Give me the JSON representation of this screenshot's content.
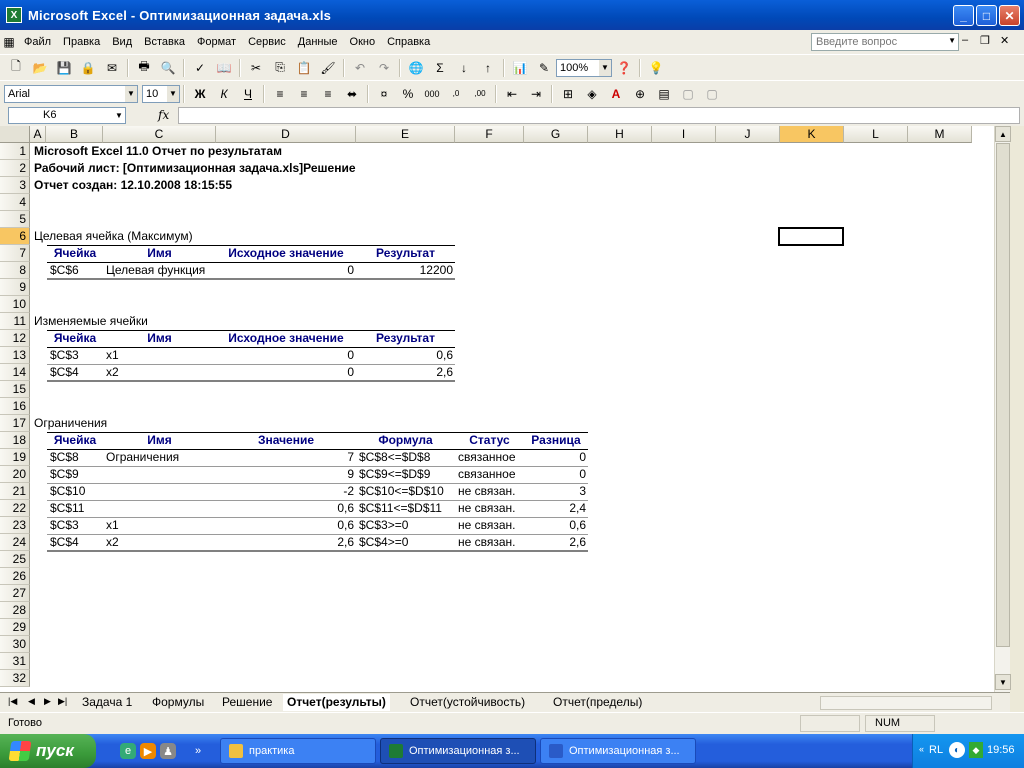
{
  "window": {
    "title": "Microsoft Excel - Оптимизационная задача.xls",
    "minimize": "_",
    "maximize": "□",
    "close": "✕"
  },
  "menu": {
    "items": [
      "Файл",
      "Правка",
      "Вид",
      "Вставка",
      "Формат",
      "Сервис",
      "Данные",
      "Окно",
      "Справка"
    ],
    "ask_placeholder": "Введите вопрос"
  },
  "toolbar": {
    "zoom": "100%",
    "font": "Arial",
    "font_size": "10"
  },
  "formula": {
    "name_box": "K6",
    "fx": "fx",
    "content": ""
  },
  "columns": [
    "A",
    "B",
    "C",
    "D",
    "E",
    "F",
    "G",
    "H",
    "I",
    "J",
    "K",
    "L",
    "M"
  ],
  "selected_column": "K",
  "selected_row": 6,
  "rows": [
    "1",
    "2",
    "3",
    "4",
    "5",
    "6",
    "7",
    "8",
    "9",
    "10",
    "11",
    "12",
    "13",
    "14",
    "15",
    "16",
    "17",
    "18",
    "19",
    "20",
    "21",
    "22",
    "23",
    "24",
    "25",
    "26",
    "27",
    "28",
    "29",
    "30",
    "31",
    "32"
  ],
  "report": {
    "line1": "Microsoft Excel 11.0 Отчет по результатам",
    "line2": "Рабочий лист: [Оптимизационная задача.xls]Решение",
    "line3": "Отчет создан: 12.10.2008 18:15:55"
  },
  "target": {
    "section": "Целевая ячейка (Максимум)",
    "headers": [
      "Ячейка",
      "Имя",
      "Исходное значение",
      "Результат"
    ],
    "rows": [
      [
        "$C$6",
        "Целевая функция",
        "0",
        "12200"
      ]
    ]
  },
  "changing": {
    "section": "Изменяемые ячейки",
    "headers": [
      "Ячейка",
      "Имя",
      "Исходное значение",
      "Результат"
    ],
    "rows": [
      [
        "$C$3",
        "x1",
        "0",
        "0,6"
      ],
      [
        "$C$4",
        "x2",
        "0",
        "2,6"
      ]
    ]
  },
  "constraints": {
    "section": "Ограничения",
    "headers": [
      "Ячейка",
      "Имя",
      "Значение",
      "Формула",
      "Статус",
      "Разница"
    ],
    "rows": [
      [
        "$C$8",
        "Ограничения",
        "7",
        "$C$8<=$D$8",
        "связанное",
        "0"
      ],
      [
        "$C$9",
        "",
        "9",
        "$C$9<=$D$9",
        "связанное",
        "0"
      ],
      [
        "$C$10",
        "",
        "-2",
        "$C$10<=$D$10",
        "не связан.",
        "3"
      ],
      [
        "$C$11",
        "",
        "0,6",
        "$C$11<=$D$11",
        "не связан.",
        "2,4"
      ],
      [
        "$C$3",
        "x1",
        "0,6",
        "$C$3>=0",
        "не связан.",
        "0,6"
      ],
      [
        "$C$4",
        "x2",
        "2,6",
        "$C$4>=0",
        "не связан.",
        "2,6"
      ]
    ]
  },
  "sheets": [
    "Задача 1",
    "Формулы",
    "Решение",
    "Отчет(результы)",
    "Отчет(устойчивость)",
    "Отчет(пределы)"
  ],
  "active_sheet": "Отчет(результы)",
  "status": {
    "left": "Готово",
    "num": "NUM"
  },
  "taskbar": {
    "start": "пуск",
    "tasks": [
      "практика",
      "Оптимизационная з...",
      "Оптимизационная з..."
    ],
    "lang": "RL",
    "time": "19:56"
  }
}
